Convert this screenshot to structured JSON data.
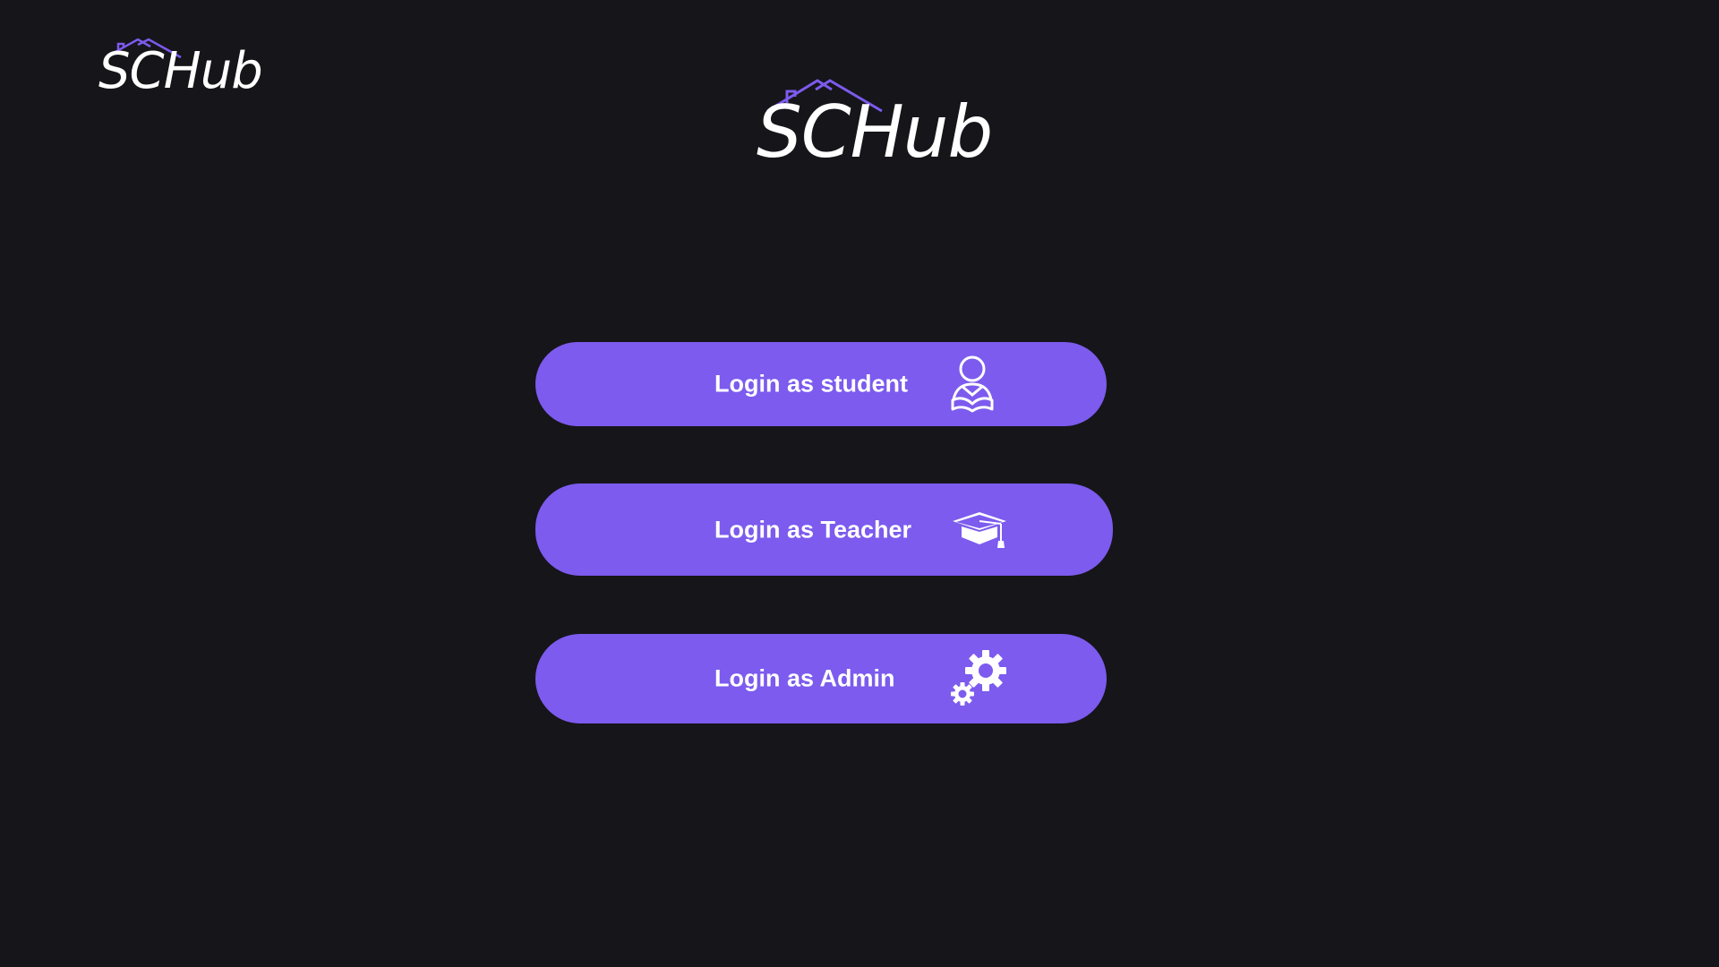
{
  "header": {
    "logo_small_text": "SCHub",
    "logo_large_text": "SCHub"
  },
  "colors": {
    "background": "#16151a",
    "accent": "#7c5bee",
    "text": "#ffffff"
  },
  "login_options": [
    {
      "label": "Login as student",
      "icon": "student-reading-icon"
    },
    {
      "label": "Login as Teacher",
      "icon": "graduation-cap-icon"
    },
    {
      "label": "Login as Admin",
      "icon": "gears-icon"
    }
  ]
}
